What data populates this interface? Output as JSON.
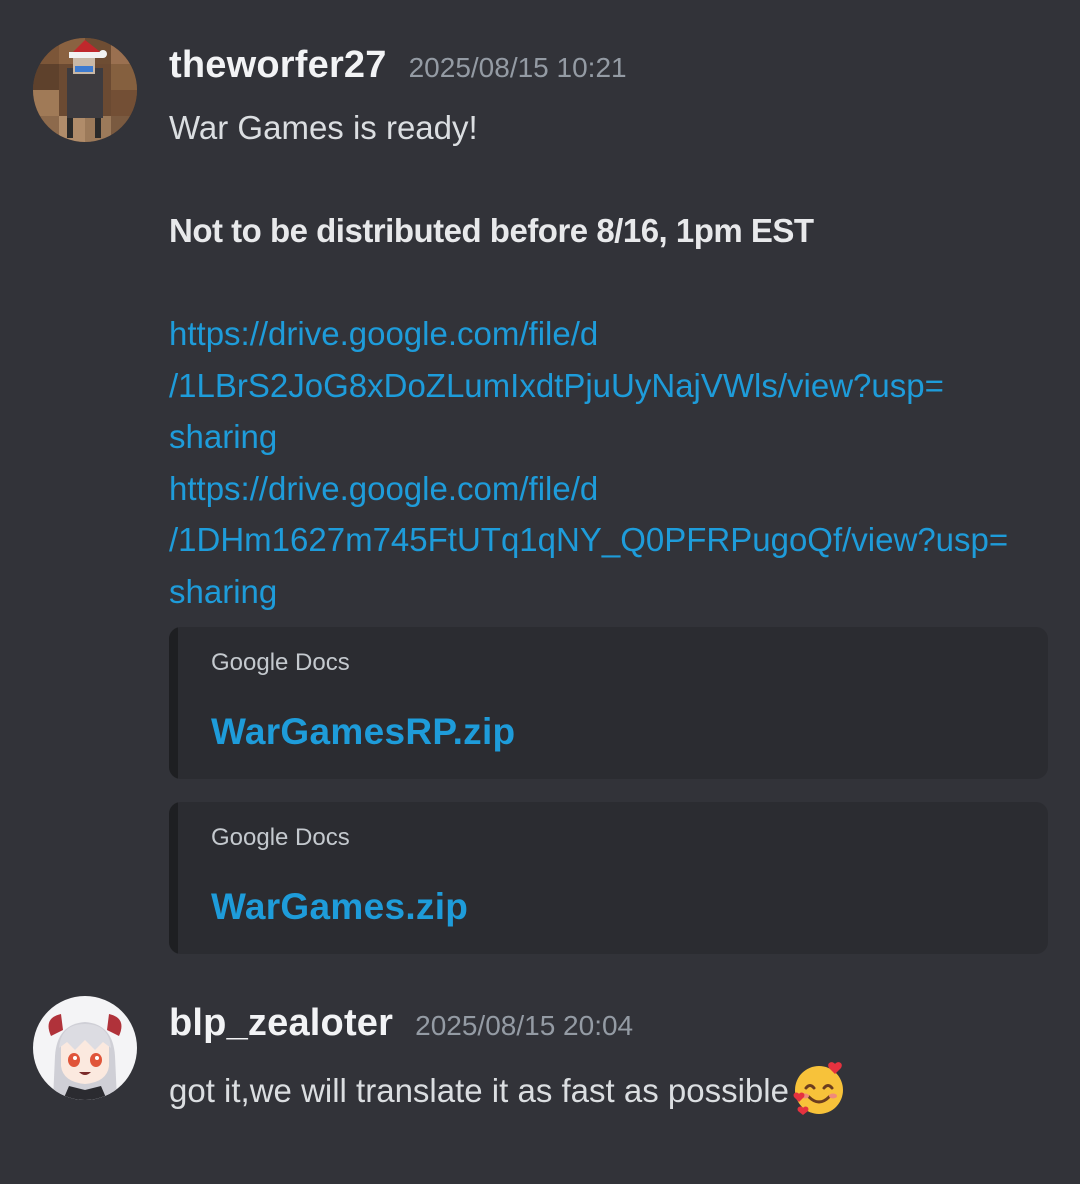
{
  "messages": [
    {
      "username": "theworfer27",
      "timestamp": "2025/08/15 10:21",
      "text_line_1": "War Games is ready!",
      "text_line_2": "Not to be distributed before 8/16, 1pm EST",
      "link_1": {
        "lines": [
          "https://drive.google.com/file/d",
          "/1LBrS2JoG8xDoZLumIxdtPjuUyNajVWls/view?usp=",
          "sharing"
        ]
      },
      "link_2": {
        "lines": [
          "https://drive.google.com/file/d",
          "/1DHm1627m745FtUTq1qNY_Q0PFRPugoQf/view?usp=",
          "sharing"
        ]
      },
      "embeds": [
        {
          "provider": "Google Docs",
          "title": "WarGamesRP.zip"
        },
        {
          "provider": "Google Docs",
          "title": "WarGames.zip"
        }
      ]
    },
    {
      "username": "blp_zealoter",
      "timestamp": "2025/08/15 20:04",
      "text": "got it,we will translate it as fast as possible",
      "emoji": "smiling-face-with-hearts-icon"
    }
  ],
  "colors": {
    "background": "#323339",
    "link": "#1e9cda",
    "embed_background": "#2b2c31",
    "timestamp": "#949ba4"
  }
}
